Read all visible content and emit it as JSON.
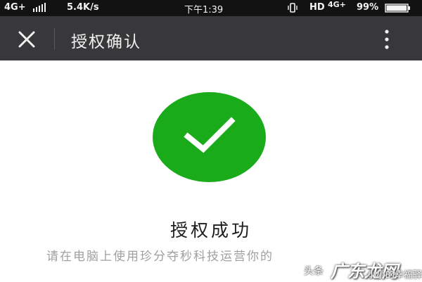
{
  "status_bar": {
    "network": "4G+",
    "speed": "5.4K/s",
    "time": "下午1:39",
    "hd": "HD",
    "network_right": "4G+",
    "battery_percent": "99%",
    "battery_level": 0.99
  },
  "header": {
    "title": "授权确认",
    "close_icon": "close-icon",
    "more_icon": "more-vertical-icon"
  },
  "main": {
    "result_title": "授权成功",
    "instruction": "请在电脑上使用珍分夺秒科技运营你的",
    "success_icon": "check-circle-icon",
    "success_color": "#1aab1a"
  },
  "watermark": {
    "prefix": "头条",
    "brand": "广东龙网",
    "site": "小小的幸福驿站"
  }
}
